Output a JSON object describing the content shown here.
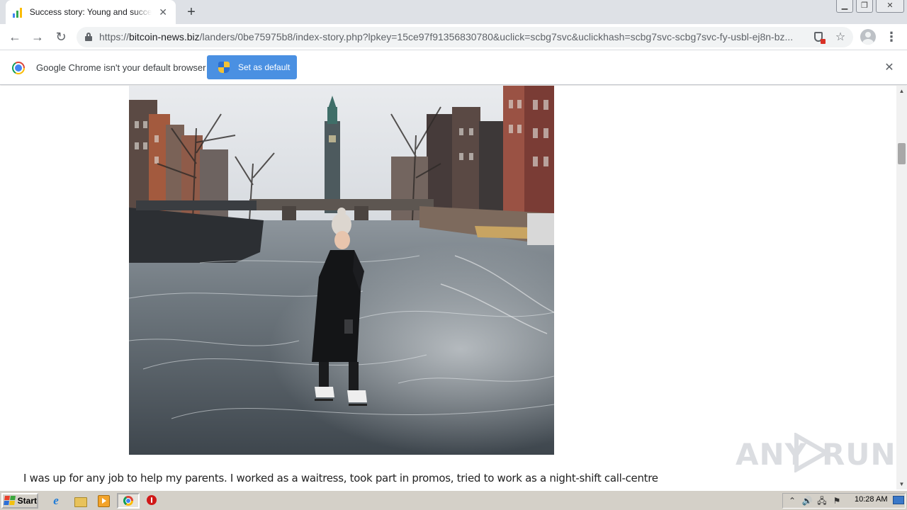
{
  "browser": {
    "tab": {
      "title": "Success story: Young and successful",
      "close_glyph": "✕"
    },
    "new_tab_glyph": "+",
    "window_controls": {
      "minimize": "▁",
      "restore": "❐",
      "close": "✕"
    },
    "nav": {
      "back": "←",
      "forward": "→",
      "reload": "↻"
    },
    "url": {
      "scheme": "https://",
      "host": "bitcoin-news.biz",
      "path": "/landers/0be75975b8/index-story.php?lpkey=15ce97f91356830780&uclick=scbg7svc&uclickhash=scbg7svc-scbg7svc-fy-usbl-ej8n-bz..."
    },
    "icons": {
      "site_info": "lock-icon",
      "extension": "shield-icon",
      "bookmark": "star-icon",
      "profile": "avatar-icon",
      "menu": "kebab-menu-icon"
    },
    "star_glyph": "☆",
    "menu_glyph": "⋮"
  },
  "infobar": {
    "message": "Google Chrome isn't your default browser",
    "button_label": "Set as default",
    "close_glyph": "✕"
  },
  "page": {
    "story_text": "I was up for any job to help my parents. I worked as a waitress, took part in promos, tried to work as a night-shift call-centre",
    "watermark": {
      "left": "ANY",
      "right": "RUN"
    }
  },
  "scrollbar": {
    "up": "▲",
    "down": "▼"
  },
  "taskbar": {
    "start_label": "Start",
    "ie_glyph": "e",
    "tray": {
      "expand": "⌃",
      "volume": "🔊",
      "network": "🖧",
      "flag": "⚑"
    },
    "clock": "10:28 AM"
  },
  "colors": {
    "accent_button": "#4a90e2",
    "tab_strip": "#dee1e6",
    "taskbar": "#d4d0c8"
  }
}
